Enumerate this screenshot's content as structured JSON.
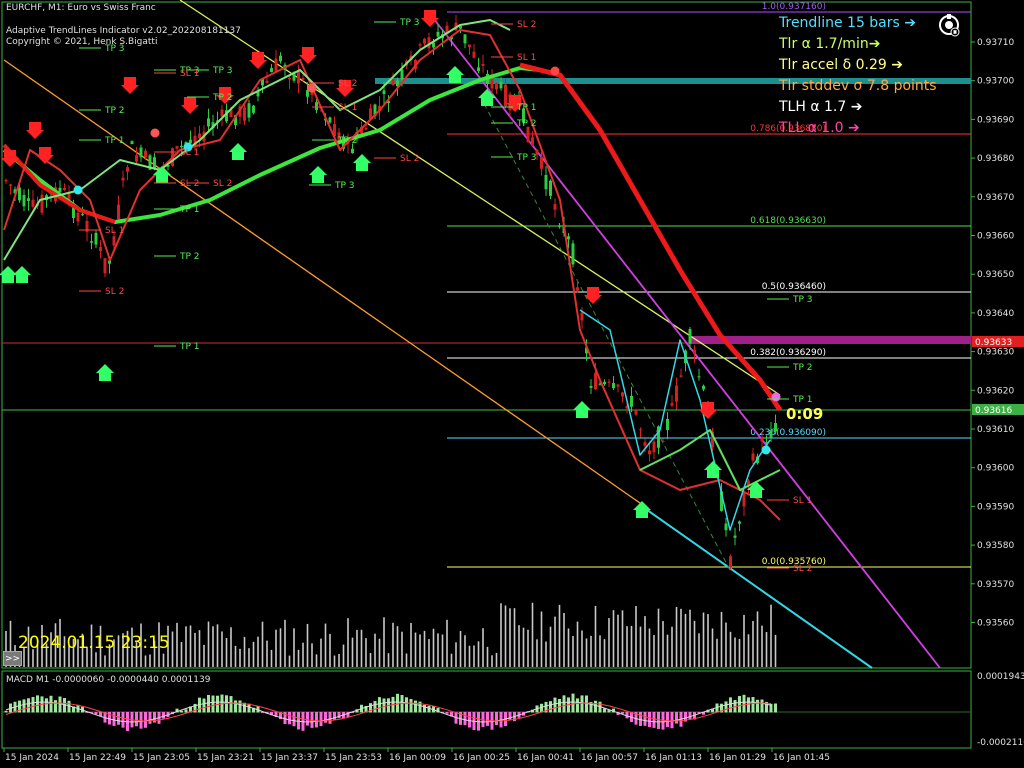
{
  "header": {
    "symbol_title": "EURCHF, M1:  Euro vs Swiss Franc",
    "indicator_name": "Adaptive TrendLines Indicator v2.02_202208181137",
    "copyright": "Copyright © 2021, Henk S.Bigatti"
  },
  "info_panel": [
    {
      "label": "Trendline 15 bars ➔",
      "color": "#55ddff"
    },
    {
      "label": "Tlr α 1.7/min➔",
      "color": "#ccff66"
    },
    {
      "label": "Tlr accel δ 0.29 ➔",
      "color": "#ffff88"
    },
    {
      "label": "Tlr stddev σ 7.8 points",
      "color": "#ffaa44"
    },
    {
      "label": "TLH α 1.7  ➔",
      "color": "#ffffff"
    },
    {
      "label": "TLL α 1.0  ➔",
      "color": "#ff44aa"
    }
  ],
  "countdown": "0:09",
  "timestamp_overlay": "2024.01.15 23:15",
  "scroll_button": ">>",
  "logo_icon": "ob-logo-icon",
  "price_axis": {
    "ticks": [
      "0.93710",
      "0.93700",
      "0.93690",
      "0.93680",
      "0.93670",
      "0.93660",
      "0.93650",
      "0.93640",
      "0.93630",
      "0.93620",
      "0.93610",
      "0.93600",
      "0.93590",
      "0.93580",
      "0.93570",
      "0.93560"
    ],
    "current_price_red": "0.93633",
    "current_price_green": "0.93616"
  },
  "macd": {
    "label": "MACD M1 -0.0000060 -0.0000440 0.0001139",
    "ticks": [
      "0.0001943",
      "-0.0002110"
    ]
  },
  "time_axis": [
    "15 Jan 2024",
    "15 Jan 22:49",
    "15 Jan 23:05",
    "15 Jan 23:21",
    "15 Jan 23:37",
    "15 Jan 23:53",
    "16 Jan 00:09",
    "16 Jan 00:25",
    "16 Jan 00:41",
    "16 Jan 00:57",
    "16 Jan 01:13",
    "16 Jan 01:29",
    "16 Jan 01:45"
  ],
  "fib_levels": [
    {
      "label": "1.0(0.937160)",
      "color": "#aa55ff"
    },
    {
      "label": "0.786(0.936880)",
      "color": "#ff3333"
    },
    {
      "label": "0.618(0.936630)",
      "color": "#55dd55"
    },
    {
      "label": "0.5(0.936460)",
      "color": "#ffffff"
    },
    {
      "label": "0.382(0.936290)",
      "color": "#ffffff"
    },
    {
      "label": "0.236(0.936090)",
      "color": "#55ddff"
    },
    {
      "label": "0.0(0.935760)",
      "color": "#ffff66"
    }
  ],
  "target_labels": [
    "TP 3",
    "TP 2",
    "TP 1",
    "SL 1",
    "SL 2",
    "TP 3",
    "TP 2",
    "TP 1",
    "SL 1",
    "SL 2",
    "TP 3",
    "TP 2",
    "TP 1",
    "SL 1",
    "SL 2",
    "TP 3",
    "SL 2",
    "TP 2",
    "SL 1",
    "TP 3",
    "TP 2",
    "TP 1",
    "SL 2",
    "SL 1",
    "TP 3",
    "SL 2",
    "TP 3",
    "TP 2",
    "TP 1",
    "SL 1",
    "SL 2"
  ]
}
